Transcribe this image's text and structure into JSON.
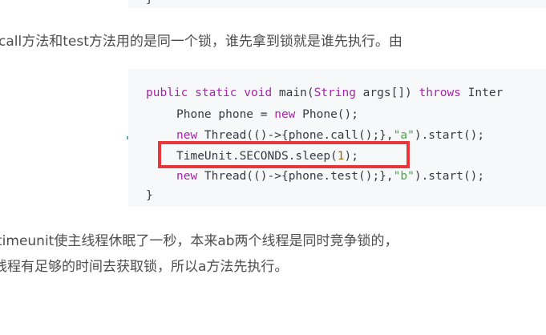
{
  "article": {
    "top_code_brace": "}",
    "paragraph_1": "call方法和test方法用的是同一个锁，谁先拿到锁就是谁先执行。由",
    "paragraph_2": "timeunit使主线程休眠了一秒，本来ab两个线程是同时竞争锁的，",
    "paragraph_3": "线程有足够的时间去获取锁，所以a方法先执行。"
  },
  "code": {
    "line1": {
      "kw1": "public",
      "kw2": "static",
      "kw3": "void",
      "rest1": " main(",
      "type": "String",
      "rest2": " args[]) ",
      "kw4": "throws",
      "rest3": " Inter"
    },
    "line2": {
      "text1": "Phone phone = ",
      "kw": "new",
      "text2": " Phone();"
    },
    "line3": {
      "kw": "new",
      "text1": " Thread(()->{phone.call();},",
      "str": "\"a\"",
      "text2": ").start();"
    },
    "line4": {
      "text1": "TimeUnit.SECONDS.sleep(",
      "num": "1",
      "text2": ");"
    },
    "line5": {
      "kw": "new",
      "text1": " Thread(()->{phone.test();},",
      "str": "\"b\"",
      "text2": ").start();"
    },
    "line6": {
      "text": "}"
    }
  },
  "colors": {
    "highlight_border": "#e8373b",
    "keyword": "#a626a4",
    "string": "#50a14f",
    "number": "#986801",
    "code_background": "#f6f8fa",
    "body_text": "#4d4d4d"
  }
}
